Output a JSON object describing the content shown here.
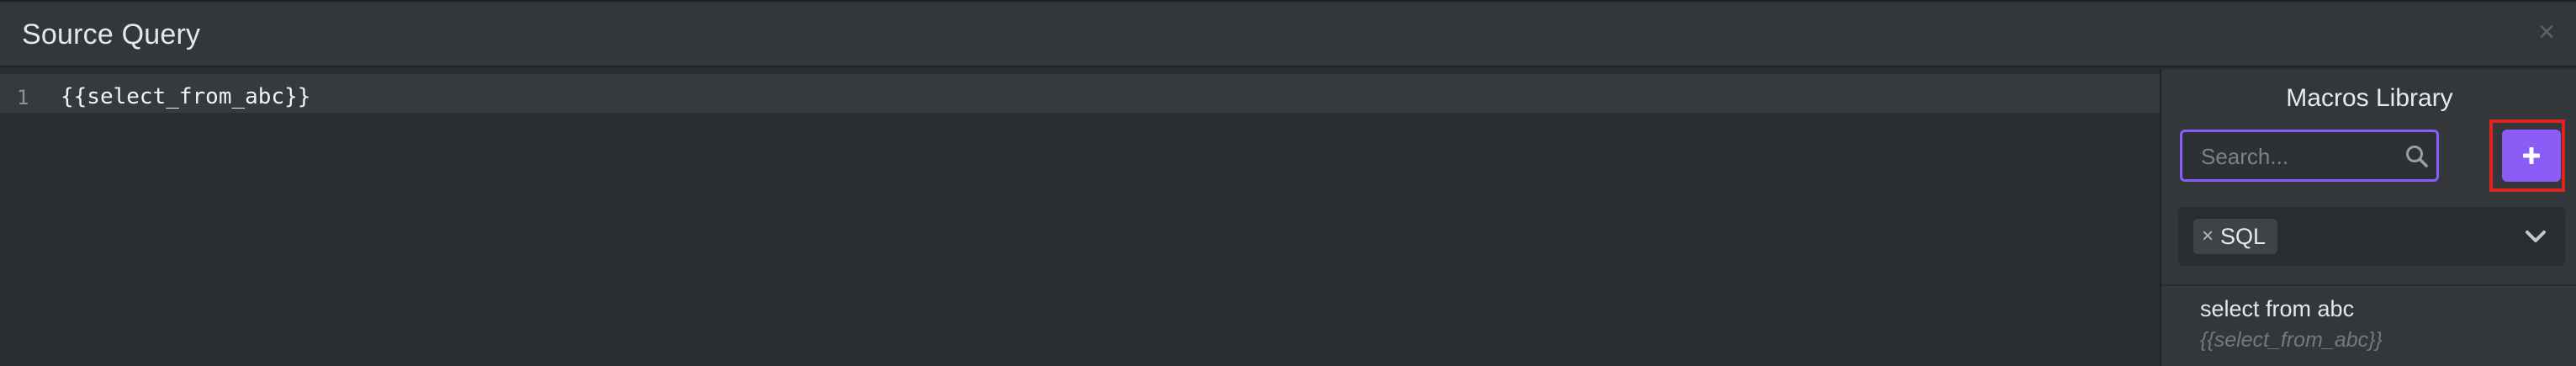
{
  "window": {
    "title": "Source Query",
    "close_icon": "×"
  },
  "editor": {
    "lines": [
      {
        "number": "1",
        "text": "{{select_from_abc}}"
      }
    ]
  },
  "library": {
    "title": "Macros Library",
    "search": {
      "placeholder": "Search...",
      "value": ""
    },
    "add_icon": "plus-icon",
    "filter": {
      "tags": [
        {
          "remove": "×",
          "label": "SQL"
        }
      ],
      "dropdown_icon": "chevron-down-icon"
    },
    "macros": [
      {
        "name": "select from abc",
        "code": "{{select_from_abc}}"
      }
    ]
  },
  "colors": {
    "accent": "#8b5cf6",
    "highlight": "#e0231c",
    "background": "#2b2e31",
    "panel": "#34373a"
  }
}
